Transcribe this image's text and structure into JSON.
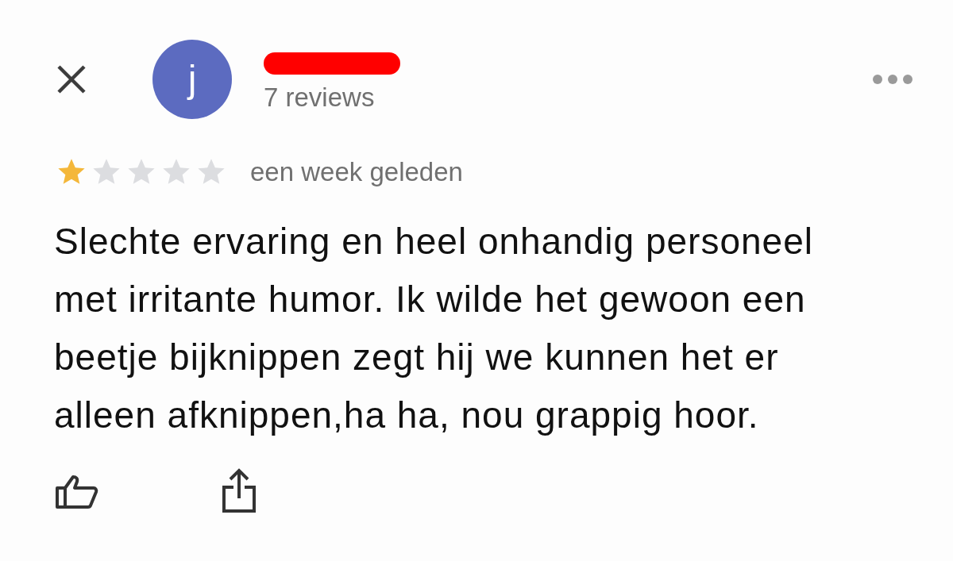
{
  "reviewer": {
    "initial": "j",
    "review_count": "7 reviews"
  },
  "review": {
    "stars": 1,
    "time": "een week geleden",
    "text": "Slechte ervaring en heel onhandig personeel met irritante humor. Ik wilde het gewoon een beetje bijknippen zegt hij we kunnen het er alleen afknippen,ha ha, nou grappig hoor."
  }
}
